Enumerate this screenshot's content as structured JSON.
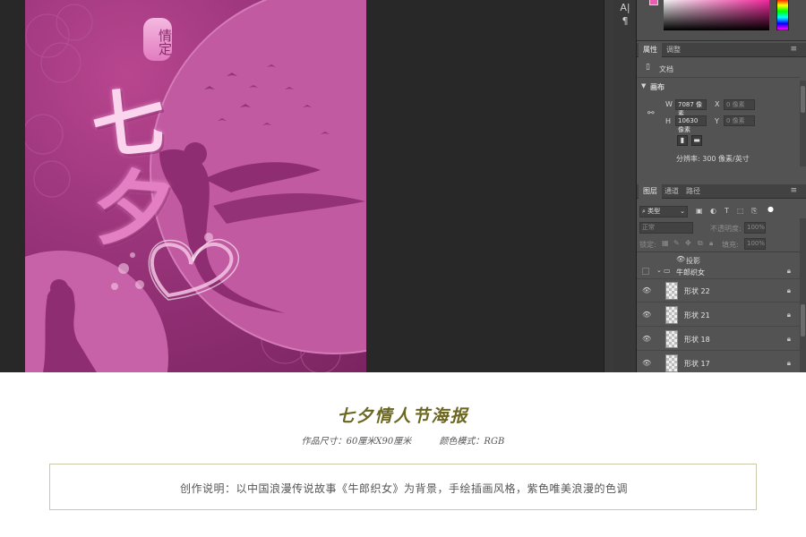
{
  "poster": {
    "tag": "情定",
    "title_char_1": "七",
    "title_char_2": "夕",
    "colors": {
      "bg": "#99347a",
      "moon": "#c760a6",
      "accent": "#f3b7df"
    }
  },
  "panel": {
    "tabs_top": [
      {
        "label": "属性"
      },
      {
        "label": "调整"
      }
    ],
    "doc_label": "文档",
    "section_title": "画布",
    "w_label": "W",
    "w_value": "7087 像素",
    "x_label": "X",
    "x_value": "0 像素",
    "h_label": "H",
    "h_value": "10630 像素",
    "y_label": "Y",
    "y_value": "0 像素",
    "resolution": "分辨率: 300 像素/英寸",
    "layer_tabs": [
      {
        "label": "图层"
      },
      {
        "label": "通道"
      },
      {
        "label": "路径"
      }
    ],
    "filter_kind": "类型",
    "blend_mode": "正常",
    "opacity_label": "不透明度:",
    "opacity_value": "100%",
    "lock_label": "锁定:",
    "fill_label": "填充:",
    "fill_value": "100%",
    "effect_label": "投影",
    "group_name": "牛郎织女",
    "layers": [
      {
        "name": "形状 22"
      },
      {
        "name": "形状 21"
      },
      {
        "name": "形状 18"
      },
      {
        "name": "形状 17"
      }
    ],
    "fg_color": "#e85fb0"
  },
  "info": {
    "title": "七夕情人节海报",
    "size": "作品尺寸：60厘米X90厘米",
    "color_mode": "颜色模式：RGB",
    "description": "创作说明：以中国浪漫传说故事《牛郎织女》为背景，手绘插画风格，紫色唯美浪漫的色调"
  }
}
